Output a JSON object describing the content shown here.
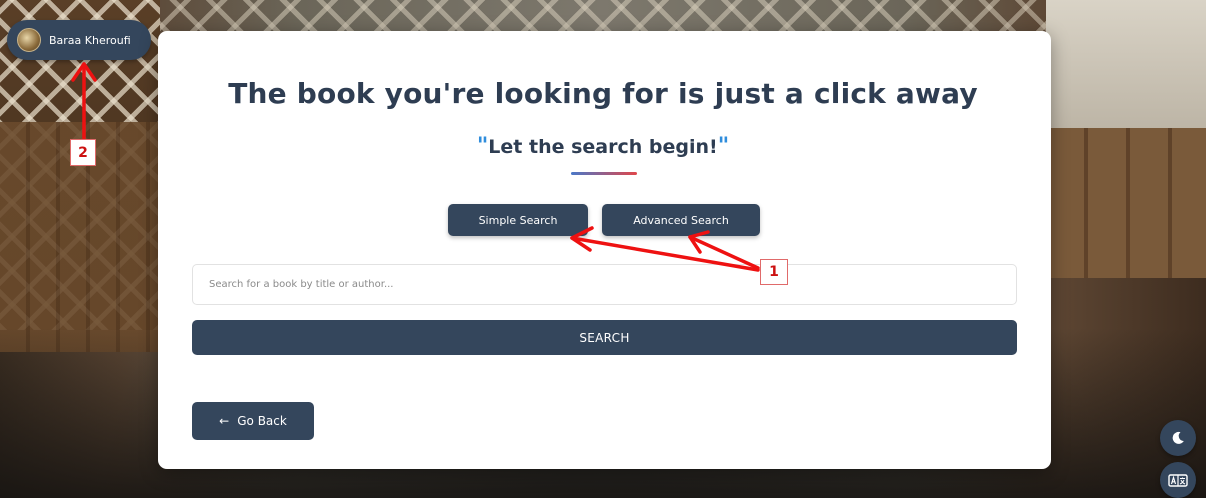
{
  "user": {
    "name": "Baraa Kheroufi"
  },
  "card": {
    "title": "The book you're looking for is just a click away",
    "subtitle_open_quote": "\"",
    "subtitle": "Let the search begin!",
    "subtitle_close_quote": "\""
  },
  "tabs": [
    {
      "label": "Simple Search"
    },
    {
      "label": "Advanced Search"
    }
  ],
  "search": {
    "placeholder": "Search for a book by title or author...",
    "value": "",
    "button_label": "SEARCH"
  },
  "back": {
    "arrow": "←",
    "label": "Go Back"
  },
  "corner_buttons": {
    "theme_icon": "moon-icon",
    "language_icon": "translate-icon"
  },
  "annotations": [
    {
      "number": "1"
    },
    {
      "number": "2"
    }
  ],
  "colors": {
    "primary": "#34465c",
    "title": "#2e3d52",
    "quote": "#2f8ddc",
    "annotation": "#cc1111"
  }
}
